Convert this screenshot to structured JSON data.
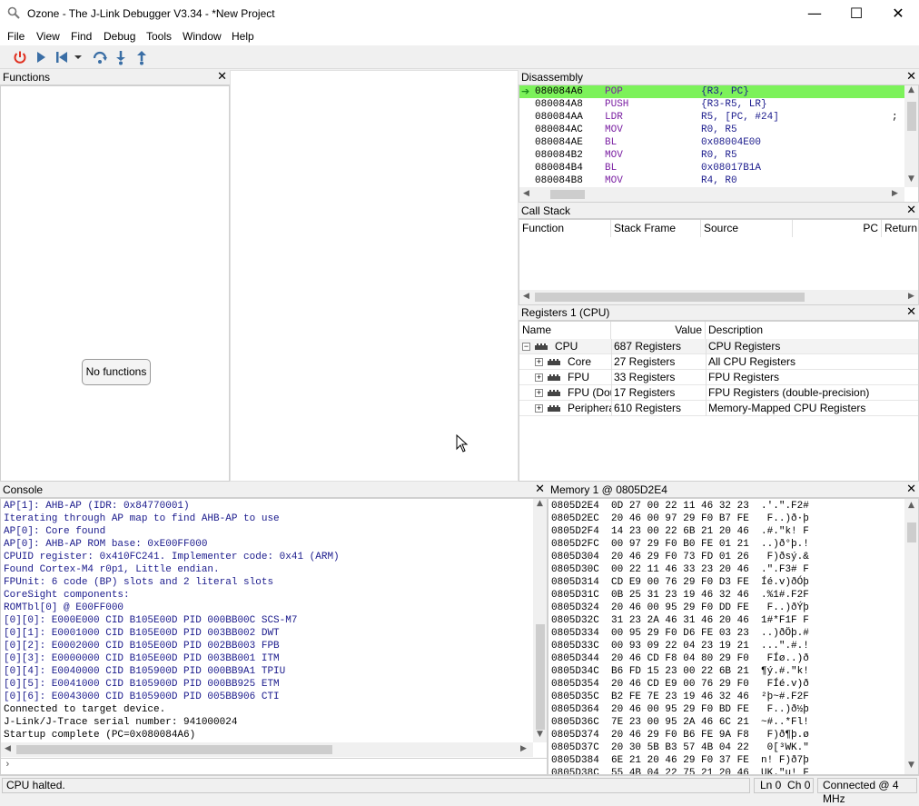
{
  "window": {
    "title": "Ozone - The J-Link Debugger V3.34 - *New Project",
    "min": "—",
    "max": "☐",
    "close": "✕"
  },
  "menu": [
    "File",
    "View",
    "Find",
    "Debug",
    "Tools",
    "Window",
    "Help"
  ],
  "toolbar": {
    "icons": [
      "power-icon",
      "continue-icon",
      "reset-icon",
      "step-over-icon",
      "step-into-icon",
      "step-out-icon"
    ],
    "accent_power": "#e03020",
    "accent_blue": "#3a6ea5"
  },
  "functions": {
    "title": "Functions",
    "empty_label": "No functions"
  },
  "disassembly": {
    "title": "Disassembly",
    "current_color": "#7cf25a",
    "rows": [
      {
        "addr": "080084A6",
        "mn": "POP",
        "op": "{R3, PC}",
        "current": true
      },
      {
        "addr": "080084A8",
        "mn": "PUSH",
        "op": "{R3-R5, LR}"
      },
      {
        "addr": "080084AA",
        "mn": "LDR",
        "op": "R5, [PC, #24]",
        "comment": ";"
      },
      {
        "addr": "080084AC",
        "mn": "MOV",
        "op": "R0, R5"
      },
      {
        "addr": "080084AE",
        "mn": "BL",
        "op": "0x08004E00"
      },
      {
        "addr": "080084B2",
        "mn": "MOV",
        "op": "R0, R5"
      },
      {
        "addr": "080084B4",
        "mn": "BL",
        "op": "0x08017B1A"
      },
      {
        "addr": "080084B8",
        "mn": "MOV",
        "op": "R4, R0"
      }
    ]
  },
  "callstack": {
    "title": "Call Stack",
    "columns": [
      "Function",
      "Stack Frame",
      "Source",
      "PC",
      "Return"
    ]
  },
  "registers": {
    "title": "Registers 1 (CPU)",
    "columns": [
      "Name",
      "Value",
      "Description"
    ],
    "rows": [
      {
        "expander": "−",
        "name": "CPU",
        "value": "687 Registers",
        "desc": "CPU Registers",
        "level": 0
      },
      {
        "expander": "+",
        "name": "Core",
        "value": "27 Registers",
        "desc": "All CPU Registers",
        "level": 1
      },
      {
        "expander": "+",
        "name": "FPU",
        "value": "33 Registers",
        "desc": "FPU Registers",
        "level": 1
      },
      {
        "expander": "+",
        "name": "FPU (Dou",
        "value": "17 Registers",
        "desc": "FPU Registers (double-precision)",
        "level": 1
      },
      {
        "expander": "+",
        "name": "Periphera",
        "value": "610 Registers",
        "desc": "Memory-Mapped CPU Registers",
        "level": 1
      }
    ]
  },
  "console": {
    "title": "Console",
    "lines": [
      {
        "t": "AP[1]: AHB-AP (IDR: 0x84770001)",
        "c": "#1a1a8c"
      },
      {
        "t": "Iterating through AP map to find AHB-AP to use",
        "c": "#1a1a8c"
      },
      {
        "t": "AP[0]: Core found",
        "c": "#1a1a8c"
      },
      {
        "t": "AP[0]: AHB-AP ROM base: 0xE00FF000",
        "c": "#1a1a8c"
      },
      {
        "t": "CPUID register: 0x410FC241. Implementer code: 0x41 (ARM)",
        "c": "#1a1a8c"
      },
      {
        "t": "Found Cortex-M4 r0p1, Little endian.",
        "c": "#1a1a8c"
      },
      {
        "t": "FPUnit: 6 code (BP) slots and 2 literal slots",
        "c": "#1a1a8c"
      },
      {
        "t": "CoreSight components:",
        "c": "#1a1a8c"
      },
      {
        "t": "ROMTbl[0] @ E00FF000",
        "c": "#1a1a8c"
      },
      {
        "t": "[0][0]: E000E000 CID B105E00D PID 000BB00C SCS-M7",
        "c": "#1a1a8c"
      },
      {
        "t": "[0][1]: E0001000 CID B105E00D PID 003BB002 DWT",
        "c": "#1a1a8c"
      },
      {
        "t": "[0][2]: E0002000 CID B105E00D PID 002BB003 FPB",
        "c": "#1a1a8c"
      },
      {
        "t": "[0][3]: E0000000 CID B105E00D PID 003BB001 ITM",
        "c": "#1a1a8c"
      },
      {
        "t": "[0][4]: E0040000 CID B105900D PID 000BB9A1 TPIU",
        "c": "#1a1a8c"
      },
      {
        "t": "[0][5]: E0041000 CID B105900D PID 000BB925 ETM",
        "c": "#1a1a8c"
      },
      {
        "t": "[0][6]: E0043000 CID B105900D PID 005BB906 CTI",
        "c": "#1a1a8c"
      },
      {
        "t": "Connected to target device.",
        "c": "#000000"
      },
      {
        "t": "J-Link/J-Trace serial number: 941000024",
        "c": "#000000"
      },
      {
        "t": "Startup complete (PC=0x080084A6)",
        "c": "#000000"
      }
    ]
  },
  "memory": {
    "title": "Memory 1 @ 0805D2E4",
    "lines": [
      "0805D2E4  0D 27 00 22 11 46 32 23  .'.\".F2#",
      "0805D2EC  20 46 00 97 29 F0 B7 FE   F..)ð·þ",
      "0805D2F4  14 23 00 22 6B 21 20 46  .#.\"k! F",
      "0805D2FC  00 97 29 F0 B0 FE 01 21  ..)ð°þ.!",
      "0805D304  20 46 29 F0 73 FD 01 26   F)ðsý.&",
      "0805D30C  00 22 11 46 33 23 20 46  .\".F3# F",
      "0805D314  CD E9 00 76 29 F0 D3 FE  Íé.v)ðÓþ",
      "0805D31C  0B 25 31 23 19 46 32 46  .%1#.F2F",
      "0805D324  20 46 00 95 29 F0 DD FE   F..)ðÝþ",
      "0805D32C  31 23 2A 46 31 46 20 46  1#*F1F F",
      "0805D334  00 95 29 F0 D6 FE 03 23  ..)ðÖþ.#",
      "0805D33C  00 93 09 22 04 23 19 21  ...\".#.!",
      "0805D344  20 46 CD F8 04 80 29 F0   FÍø..)ð",
      "0805D34C  B6 FD 15 23 00 22 6B 21  ¶ý.#.\"k!",
      "0805D354  20 46 CD E9 00 76 29 F0   FÍé.v)ð",
      "0805D35C  B2 FE 7E 23 19 46 32 46  ²þ~#.F2F",
      "0805D364  20 46 00 95 29 F0 BD FE   F..)ð½þ",
      "0805D36C  7E 23 00 95 2A 46 6C 21  ~#..*Fl!",
      "0805D374  20 46 29 F0 B6 FE 9A F8   F)ð¶þ.ø",
      "0805D37C  20 30 5B B3 57 4B 04 22   0[³WK.\"",
      "0805D384  6E 21 20 46 29 F0 37 FE  n! F)ð7þ",
      "0805D38C  55 4B 04 22 75 21 20 46  UK.\"u! F"
    ]
  },
  "status": {
    "message": "CPU halted.",
    "position": "Ln 0  Ch 0",
    "connection": "Connected @ 4 MHz"
  }
}
